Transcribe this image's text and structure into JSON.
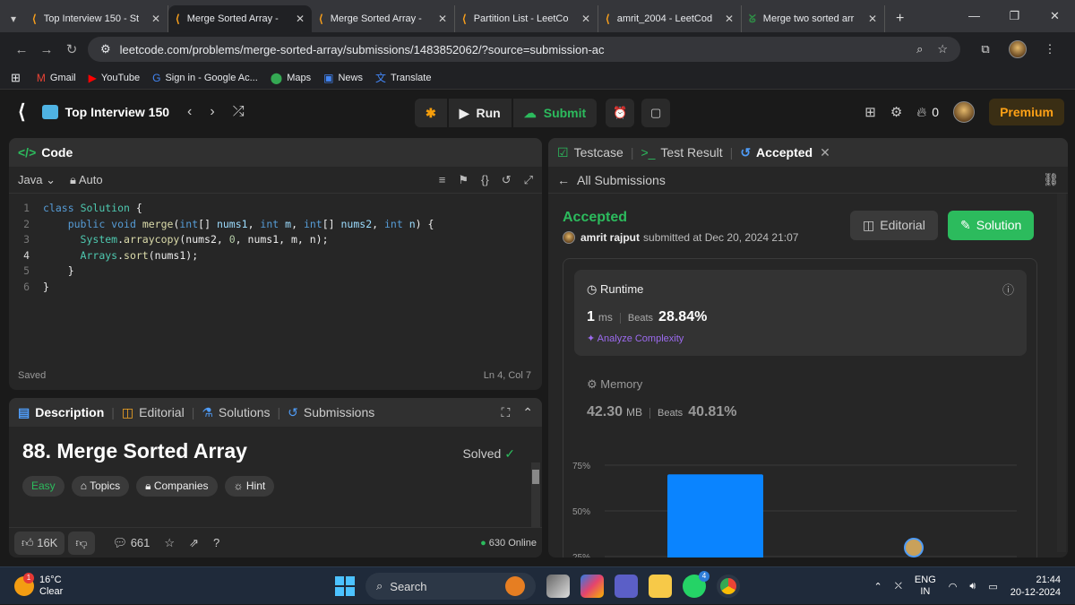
{
  "browser": {
    "tabs": [
      {
        "label": "Top Interview 150 - St",
        "active": false
      },
      {
        "label": "Merge Sorted Array -",
        "active": true
      },
      {
        "label": "Merge Sorted Array -",
        "active": false
      },
      {
        "label": "Partition List - LeetCo",
        "active": false
      },
      {
        "label": "amrit_2004 - LeetCod",
        "active": false
      },
      {
        "label": "Merge two sorted arr",
        "active": false
      }
    ],
    "url": "leetcode.com/problems/merge-sorted-array/submissions/1483852062/?source=submission-ac",
    "bookmarks": [
      {
        "label": "Gmail",
        "icon": "gmail-icon"
      },
      {
        "label": "YouTube",
        "icon": "youtube-icon"
      },
      {
        "label": "Sign in - Google Ac...",
        "icon": "google-icon"
      },
      {
        "label": "Maps",
        "icon": "maps-icon"
      },
      {
        "label": "News",
        "icon": "news-icon"
      },
      {
        "label": "Translate",
        "icon": "translate-icon"
      }
    ]
  },
  "header": {
    "problem_list": "Top Interview 150",
    "run_label": "Run",
    "submit_label": "Submit",
    "streak": "0",
    "premium_label": "Premium"
  },
  "code_panel": {
    "title": "Code",
    "language": "Java",
    "mode": "Auto",
    "line_numbers": [
      "1",
      "2",
      "3",
      "4",
      "5",
      "6"
    ],
    "status": "Saved",
    "cursor": "Ln 4, Col 7"
  },
  "description": {
    "tabs": [
      "Description",
      "Editorial",
      "Solutions",
      "Submissions"
    ],
    "title": "88. Merge Sorted Array",
    "solved_label": "Solved",
    "chips": [
      "Easy",
      "Topics",
      "Companies",
      "Hint"
    ],
    "likes": "16K",
    "comments": "661",
    "online": "630 Online"
  },
  "result_panel": {
    "tabs": [
      "Testcase",
      "Test Result",
      "Accepted"
    ],
    "all_submissions": "All Submissions",
    "status": "Accepted",
    "user": "amrit rajput",
    "submitted_text": "submitted at Dec 20, 2024 21:07",
    "editorial_label": "Editorial",
    "solution_label": "Solution",
    "runtime": {
      "label": "Runtime",
      "value": "1",
      "unit": "ms",
      "beats_label": "Beats",
      "beats": "28.84%",
      "analyze": "Analyze Complexity"
    },
    "memory": {
      "label": "Memory",
      "value": "42.30",
      "unit": "MB",
      "beats_label": "Beats",
      "beats": "40.81%"
    }
  },
  "chart_data": {
    "type": "bar",
    "yticks": [
      "75%",
      "50%",
      "25%"
    ],
    "values": [
      70
    ],
    "color": "#0a84ff"
  },
  "taskbar": {
    "temperature": "16°C",
    "weather": "Clear",
    "weather_badge": "1",
    "search_label": "Search",
    "whatsapp_badge": "4",
    "lang": "ENG",
    "region": "IN",
    "time": "21:44",
    "date": "20-12-2024"
  }
}
